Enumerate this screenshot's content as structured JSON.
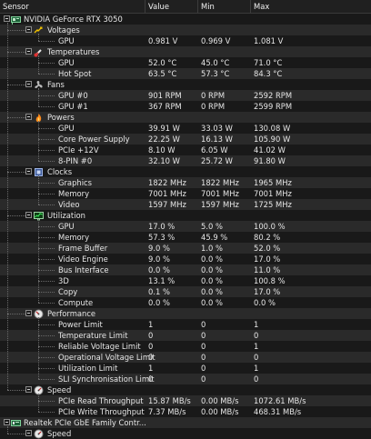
{
  "columns": [
    "Sensor",
    "Value",
    "Min",
    "Max"
  ],
  "device": {
    "name": "NVIDIA GeForce RTX 3050",
    "icon": "gpu-card-icon"
  },
  "groups": [
    {
      "name": "Voltages",
      "icon": "voltage-icon",
      "rows": [
        {
          "name": "GPU",
          "value": "0.981 V",
          "min": "0.969 V",
          "max": "1.081 V"
        }
      ]
    },
    {
      "name": "Temperatures",
      "icon": "thermometer-icon",
      "rows": [
        {
          "name": "GPU",
          "value": "52.0 °C",
          "min": "45.0 °C",
          "max": "71.0 °C"
        },
        {
          "name": "Hot Spot",
          "value": "63.5 °C",
          "min": "57.3 °C",
          "max": "84.3 °C"
        }
      ]
    },
    {
      "name": "Fans",
      "icon": "fan-icon",
      "rows": [
        {
          "name": "GPU #0",
          "value": "901 RPM",
          "min": "0 RPM",
          "max": "2592 RPM"
        },
        {
          "name": "GPU #1",
          "value": "367 RPM",
          "min": "0 RPM",
          "max": "2599 RPM"
        }
      ]
    },
    {
      "name": "Powers",
      "icon": "flame-icon",
      "rows": [
        {
          "name": "GPU",
          "value": "39.91 W",
          "min": "33.03 W",
          "max": "130.08 W"
        },
        {
          "name": "Core Power Supply",
          "value": "22.25 W",
          "min": "16.13 W",
          "max": "105.90 W"
        },
        {
          "name": "PCIe +12V",
          "value": "8.10 W",
          "min": "6.05 W",
          "max": "41.02 W"
        },
        {
          "name": "8-PIN #0",
          "value": "32.10 W",
          "min": "25.72 W",
          "max": "91.80 W"
        }
      ]
    },
    {
      "name": "Clocks",
      "icon": "clock-chip-icon",
      "rows": [
        {
          "name": "Graphics",
          "value": "1822 MHz",
          "min": "1822 MHz",
          "max": "1965 MHz"
        },
        {
          "name": "Memory",
          "value": "7001 MHz",
          "min": "7001 MHz",
          "max": "7001 MHz"
        },
        {
          "name": "Video",
          "value": "1597 MHz",
          "min": "1597 MHz",
          "max": "1725 MHz"
        }
      ]
    },
    {
      "name": "Utilization",
      "icon": "monitor-graph-icon",
      "rows": [
        {
          "name": "GPU",
          "value": "17.0 %",
          "min": "5.0 %",
          "max": "100.0 %"
        },
        {
          "name": "Memory",
          "value": "57.3 %",
          "min": "45.9 %",
          "max": "80.2 %"
        },
        {
          "name": "Frame Buffer",
          "value": "9.0 %",
          "min": "1.0 %",
          "max": "52.0 %"
        },
        {
          "name": "Video Engine",
          "value": "9.0 %",
          "min": "0.0 %",
          "max": "17.0 %"
        },
        {
          "name": "Bus Interface",
          "value": "0.0 %",
          "min": "0.0 %",
          "max": "11.0 %"
        },
        {
          "name": "3D",
          "value": "13.1 %",
          "min": "0.0 %",
          "max": "100.8 %"
        },
        {
          "name": "Copy",
          "value": "0.1 %",
          "min": "0.0 %",
          "max": "17.0 %"
        },
        {
          "name": "Compute",
          "value": "0.0 %",
          "min": "0.0 %",
          "max": "0.0 %"
        }
      ]
    },
    {
      "name": "Performance",
      "icon": "gauge-icon",
      "rows": [
        {
          "name": "Power Limit",
          "value": "1",
          "min": "0",
          "max": "1"
        },
        {
          "name": "Temperature Limit",
          "value": "0",
          "min": "0",
          "max": "0"
        },
        {
          "name": "Reliable Voltage Limit",
          "value": "0",
          "min": "0",
          "max": "1"
        },
        {
          "name": "Operational Voltage Limit",
          "value": "0",
          "min": "0",
          "max": "0"
        },
        {
          "name": "Utilization Limit",
          "value": "1",
          "min": "0",
          "max": "1"
        },
        {
          "name": "SLI Synchronisation Limit",
          "value": "0",
          "min": "0",
          "max": "0"
        }
      ]
    },
    {
      "name": "Speed",
      "icon": "speedometer-icon",
      "rows": [
        {
          "name": "PCIe Read Throughput",
          "value": "15.87 MB/s",
          "min": "0.00 MB/s",
          "max": "1072.61 MB/s"
        },
        {
          "name": "PCIe Write Throughput",
          "value": "7.37 MB/s",
          "min": "0.00 MB/s",
          "max": "468.31 MB/s"
        }
      ]
    }
  ],
  "device2": {
    "name": "Realtek PCIe GbE Family Contr...",
    "icon": "network-card-icon"
  },
  "device2_groups": [
    {
      "name": "Speed",
      "icon": "speedometer-icon"
    }
  ],
  "colors": {
    "background": "#191919",
    "row_alt": "#2a2a2a",
    "header": "#202020",
    "text": "#e6e6e6"
  }
}
